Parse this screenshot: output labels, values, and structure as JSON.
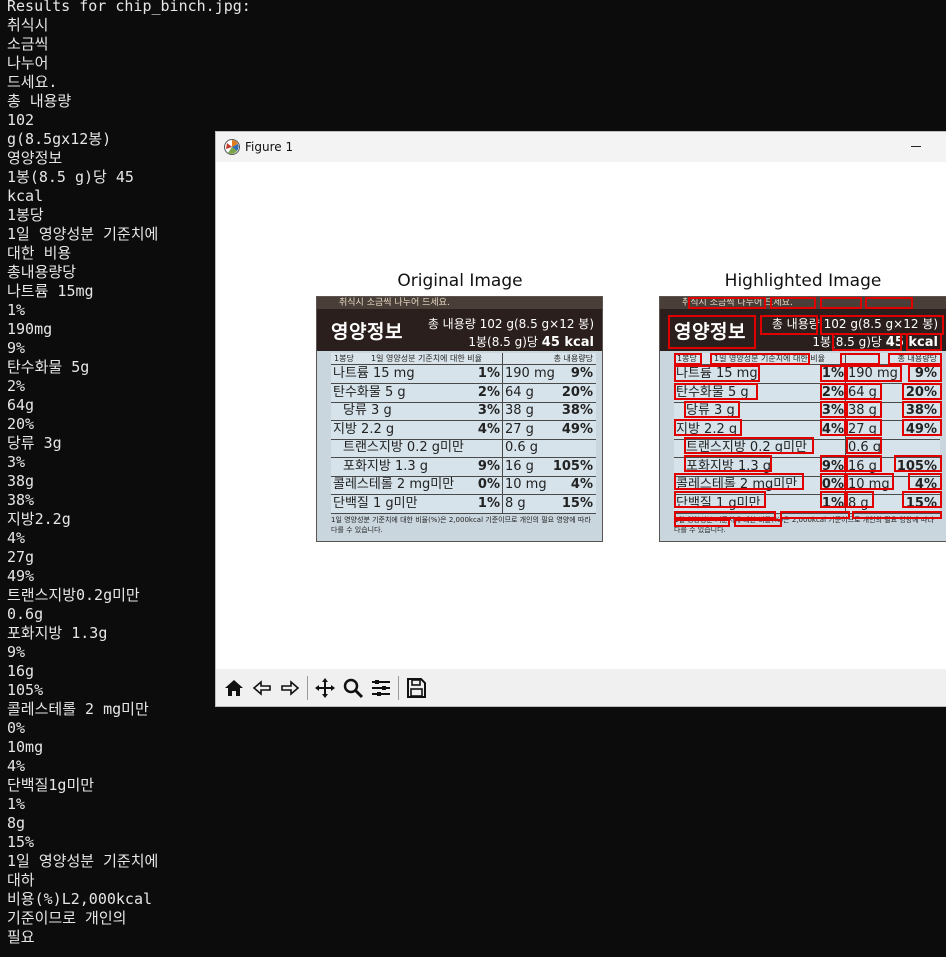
{
  "terminal": {
    "lines": [
      "Results for chip_binch.jpg:",
      "취식시",
      "소금씩",
      "나누어",
      "드세요.",
      "총 내용량",
      "102",
      "g(8.5gx12봉)",
      "영양정보",
      "1봉(8.5 g)당 45",
      "kcal",
      "1봉당",
      "1일 영양성분 기준치에",
      "대한 비용",
      "총내용량당",
      "나트륨 15mg",
      "1%",
      "190mg",
      "9%",
      "탄수화물 5g",
      "2%",
      "64g",
      "20%",
      "당류 3g",
      "3%",
      "38g",
      "38%",
      "지방2.2g",
      "4%",
      "27g",
      "49%",
      "트랜스지방0.2g미만",
      "0.6g",
      "포화지방 1.3g",
      "9%",
      "16g",
      "105%",
      "콜레스테롤 2 mg미만",
      "0%",
      "10mg",
      "4%",
      "단백질1g미만",
      "1%",
      "8g",
      "15%",
      "1일 영양성분 기준치에",
      "대하",
      "비용(%)L2,000kcal",
      "기준이므로 개인의",
      "필요"
    ]
  },
  "window": {
    "title": "Figure 1",
    "app_icon": "matplotlib-icon",
    "minimize_icon": "minimize-icon"
  },
  "figure": {
    "left_title": "Original Image",
    "right_title": "Highlighted Image",
    "label": {
      "top_text": "취식시 소금씩 나누어 드세요.",
      "heading": "영양정보",
      "total": "총 내용량 102 g(8.5 g×12 봉)",
      "per_serving": "1봉(8.5 g)당",
      "kcal": "45 kcal",
      "header_left": "1봉당",
      "header_mid": "1일 영양성분 기준치에 대한 비율",
      "header_right": "총 내용량당",
      "rows": [
        {
          "name": "나트륨 15 mg",
          "pct": "1%",
          "total": "190 mg",
          "tpct": "9%"
        },
        {
          "name": "탄수화물 5 g",
          "pct": "2%",
          "total": "64 g",
          "tpct": "20%"
        },
        {
          "name": "당류 3 g",
          "pct": "3%",
          "total": "38 g",
          "tpct": "38%"
        },
        {
          "name": "지방 2.2 g",
          "pct": "4%",
          "total": "27 g",
          "tpct": "49%"
        },
        {
          "name": "트랜스지방 0.2 g미만",
          "pct": "",
          "total": "0.6 g",
          "tpct": ""
        },
        {
          "name": "포화지방 1.3 g",
          "pct": "9%",
          "total": "16 g",
          "tpct": "105%"
        },
        {
          "name": "콜레스테롤 2 mg미만",
          "pct": "0%",
          "total": "10 mg",
          "tpct": "4%"
        },
        {
          "name": "단백질 1 g미만",
          "pct": "1%",
          "total": "8 g",
          "tpct": "15%"
        }
      ],
      "footer": "1일 영양성분 기준치에 대한 비율(%)은 2,000kcal 기준이므로 개인의 필요 영양에 따라 다를 수 있습니다."
    }
  },
  "toolbar": {
    "buttons": [
      "home-icon",
      "back-icon",
      "forward-icon",
      "pan-icon",
      "zoom-icon",
      "configure-icon",
      "save-icon"
    ]
  }
}
